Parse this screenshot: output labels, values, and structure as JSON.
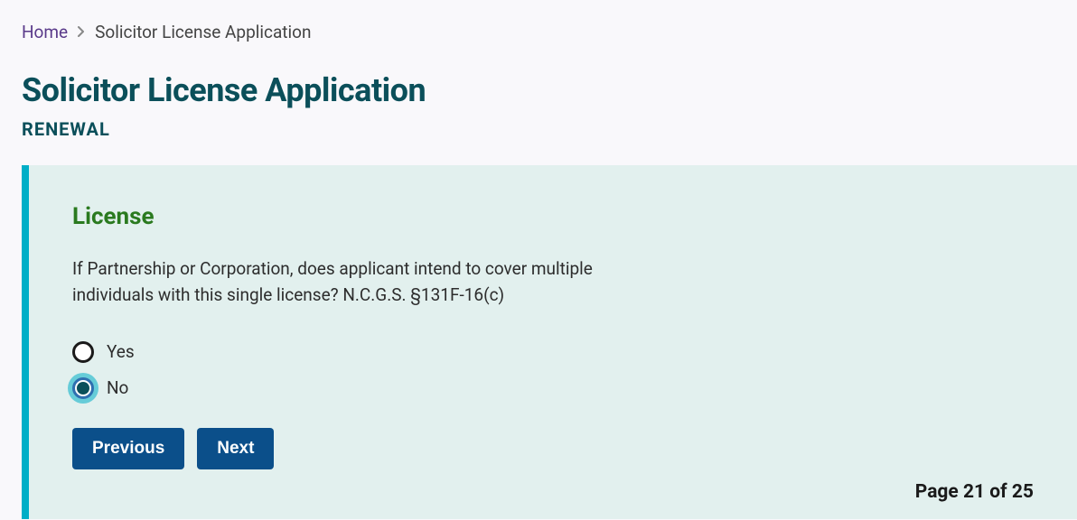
{
  "breadcrumb": {
    "home": "Home",
    "current": "Solicitor License Application"
  },
  "header": {
    "title": "Solicitor License Application",
    "subtitle": "RENEWAL"
  },
  "panel": {
    "section_title": "License",
    "question": "If Partnership or Corporation, does applicant intend to cover multiple individuals with this single license? N.C.G.S. §131F-16(c)",
    "options": {
      "yes": "Yes",
      "no": "No"
    },
    "buttons": {
      "previous": "Previous",
      "next": "Next"
    },
    "page_indicator": "Page 21 of 25"
  }
}
